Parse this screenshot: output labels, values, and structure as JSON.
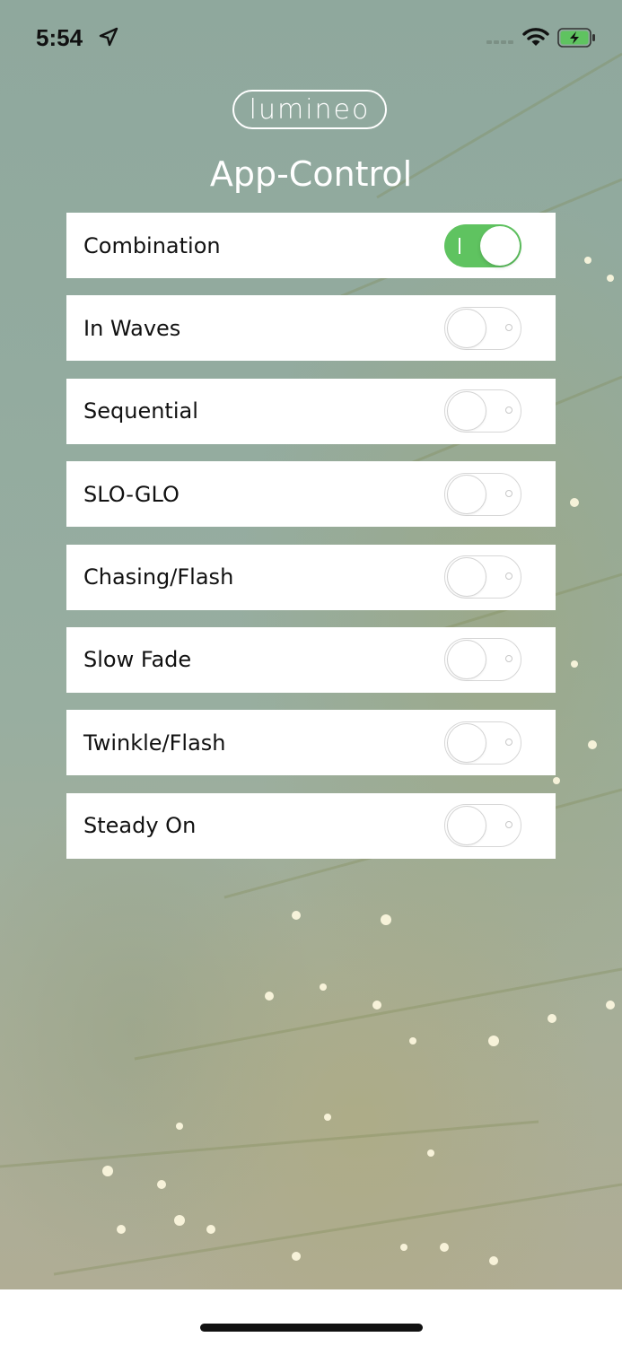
{
  "status_bar": {
    "time": "5:54",
    "icons": [
      "location-arrow-icon",
      "cellular-signal-icon",
      "wifi-icon",
      "battery-charging-icon"
    ]
  },
  "header": {
    "logo": "lumineo",
    "title": "App-Control"
  },
  "modes": [
    {
      "label": "Combination",
      "on": true
    },
    {
      "label": "In Waves",
      "on": false
    },
    {
      "label": "Sequential",
      "on": false
    },
    {
      "label": "SLO-GLO",
      "on": false
    },
    {
      "label": "Chasing/Flash",
      "on": false
    },
    {
      "label": "Slow Fade",
      "on": false
    },
    {
      "label": "Twinkle/Flash",
      "on": false
    },
    {
      "label": "Steady On",
      "on": false
    }
  ],
  "colors": {
    "toggle_on": "#5fc360",
    "toggle_off_border": "#d6d6d6",
    "battery": "#5fc360"
  }
}
